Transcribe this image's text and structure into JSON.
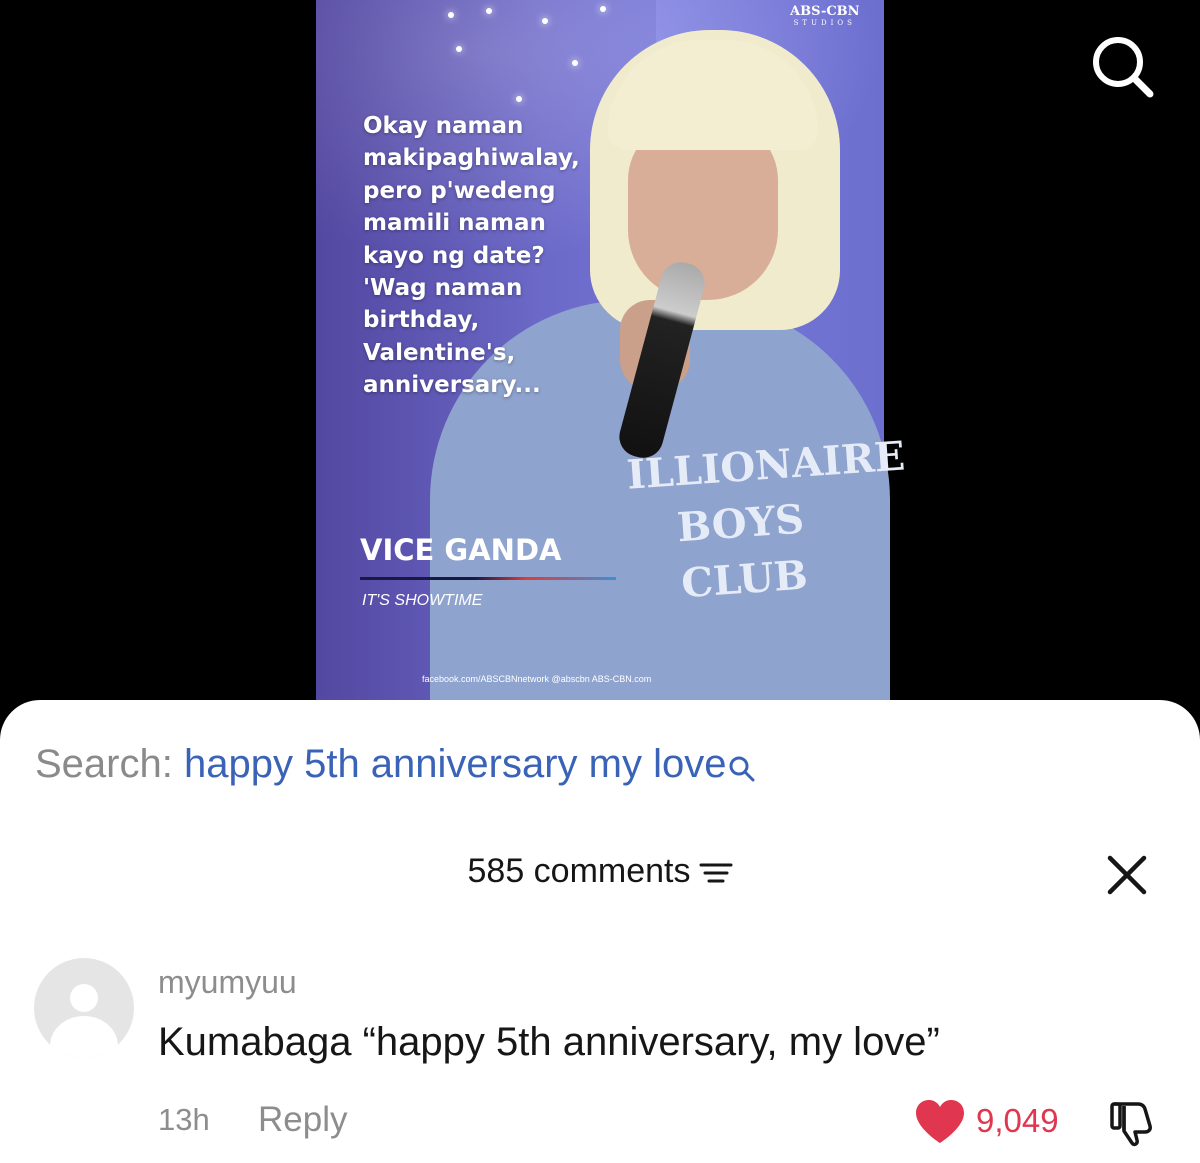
{
  "video": {
    "brand_name": "ABS-CBN",
    "brand_sub": "STUDIOS",
    "quote_lines": [
      "Okay naman",
      "makipaghiwalay,",
      "pero p'wedeng",
      "mamili naman",
      "kayo ng date?",
      "'Wag naman",
      "birthday,",
      "Valentine's,",
      "anniversary..."
    ],
    "speaker_name": "VICE GANDA",
    "show_name": "IT'S SHOWTIME",
    "sweater_print": "ILLIONAIRE BOYS CLUB",
    "socials": "facebook.com/ABSCBNnetwork   @abscbn   ABS-CBN.com",
    "accent_colors": {
      "rule_dark": "#1a1a40",
      "rule_red": "#e03b3b",
      "rule_blue": "#3b8fd8"
    }
  },
  "search_button_icon": "search-icon",
  "search": {
    "prefix": "Search:",
    "term": "happy 5th anniversary my love",
    "icon": "search-icon",
    "term_color": "#3a63b8"
  },
  "comments": {
    "count_label": "585 comments",
    "filter_icon": "filter-icon",
    "close_icon": "close-icon"
  },
  "comment": {
    "username": "myumyuu",
    "text": "Kumabaga “happy 5th anniversary, my love”",
    "time": "13h",
    "reply_label": "Reply",
    "likes": "9,049",
    "like_icon": "heart-icon",
    "like_color": "#e0364f",
    "dislike_icon": "thumbs-down-icon"
  }
}
